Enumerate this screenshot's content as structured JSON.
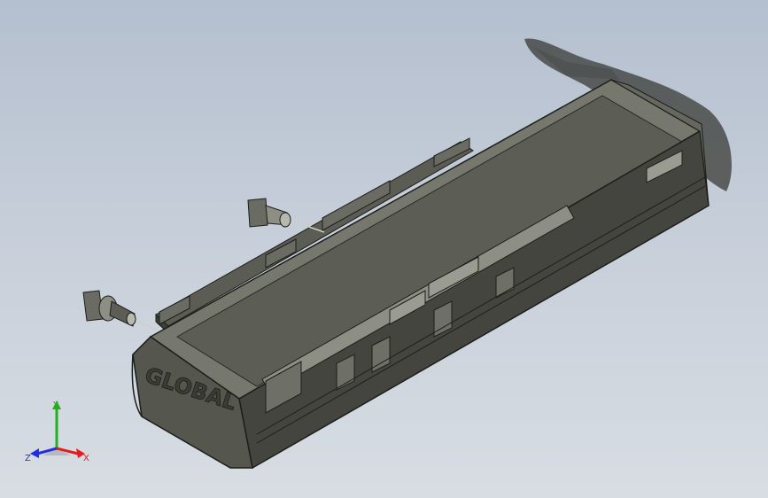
{
  "model": {
    "logo_text": "GLOBAL"
  },
  "triad": {
    "x_label": "X",
    "y_label": "Y",
    "z_label": "Z",
    "colors": {
      "x": "#e02020",
      "y": "#20b020",
      "z": "#2030e0"
    }
  },
  "colors": {
    "background_top": "#b4bfcf",
    "background_bottom": "#d8dde3",
    "body_dark": "#3e3f38",
    "body_mid": "#5e5f56",
    "body_light": "#8d8e84",
    "edge": "#1d1e1a"
  }
}
